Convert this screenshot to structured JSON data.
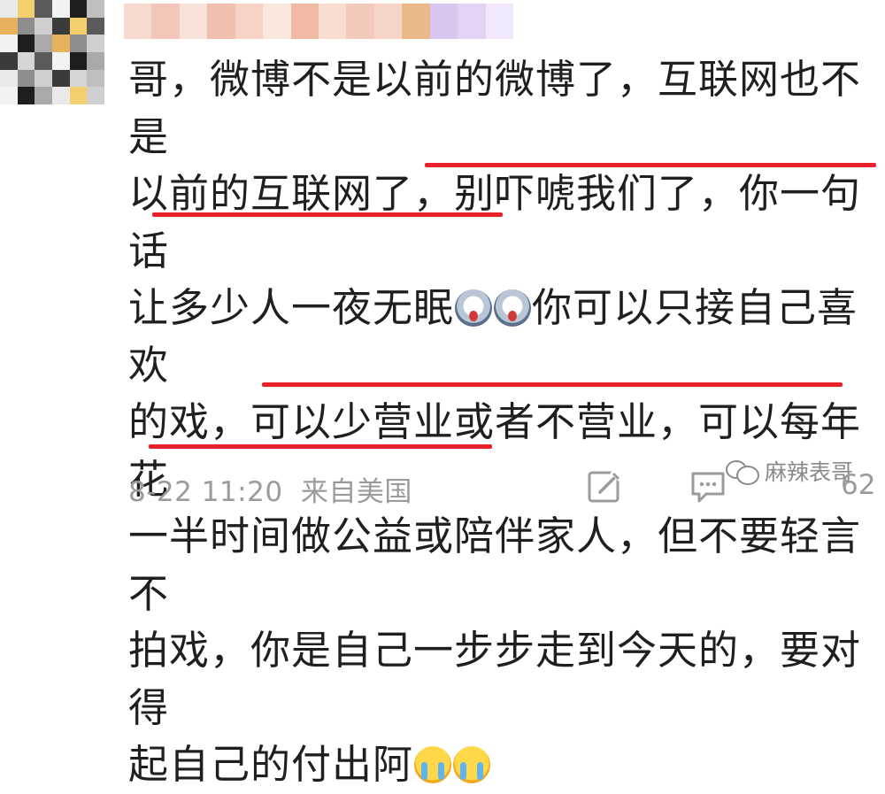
{
  "comment": {
    "text_lines": [
      "哥，微博不是以前的微博了，互联网也不是",
      "以前的互联网了，别吓唬我们了，你一句话",
      "让多少人一夜无眠",
      "你可以只接自己喜欢",
      "的戏，可以少营业或者不营业，可以每年花",
      "一半时间做公益或陪伴家人，但不要轻言不",
      "拍戏，你是自己一步步走到今天的，要对得",
      "起自己的付出阿"
    ],
    "emojis": [
      "wow-face",
      "wow-face",
      "crying-face",
      "crying-face"
    ],
    "highlight_color": "#e8212a"
  },
  "meta": {
    "timestamp": "8-22 11:20",
    "source": "来自美国"
  },
  "actions": {
    "like_count": "62"
  },
  "watermark": {
    "text": "麻辣表哥"
  },
  "colors": {
    "text": "#1f1f1f",
    "meta": "#9b9b9b",
    "underline": "#e8212a"
  }
}
